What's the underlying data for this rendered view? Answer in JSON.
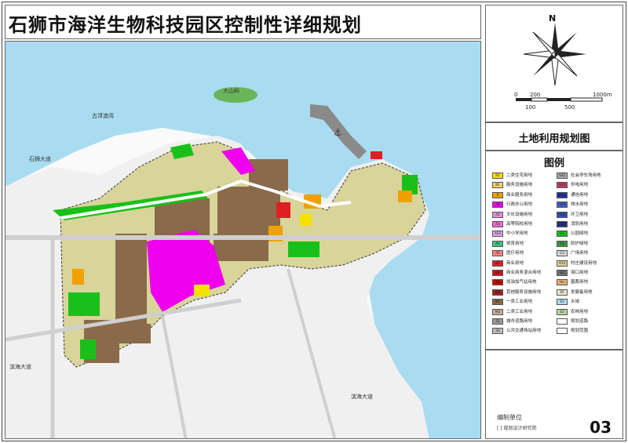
{
  "title": "石狮市海洋生物科技园区控制性详细规划",
  "map_name": "土地利用规划图",
  "legend_title": "图例",
  "compass": {
    "north": "N",
    "icon": "compass-rose-icon"
  },
  "scale": {
    "ticks": [
      "0",
      "200",
      "1000m",
      "100",
      "500"
    ]
  },
  "places": {
    "island": "大山屿",
    "bay": "古浮澳湾",
    "road_left": "石狮大道",
    "road_bottom_left": "滨海大道",
    "road_bottom_right": "滨海大道"
  },
  "legend": [
    {
      "code": "R2",
      "label": "二类住宅用地",
      "color": "#f5e100"
    },
    {
      "code": "B1",
      "label": "服务设施用地",
      "color": "#f3d06a"
    },
    {
      "code": "B",
      "label": "商业服务用地",
      "color": "#f0a000"
    },
    {
      "code": "A1",
      "label": "行政办公用地",
      "color": "#ee00ee"
    },
    {
      "code": "A2",
      "label": "文化设施用地",
      "color": "#e090e0"
    },
    {
      "code": "A3",
      "label": "高等院校用地",
      "color": "#f26ad6"
    },
    {
      "code": "A33",
      "label": "中小学用地",
      "color": "#e6a2e6"
    },
    {
      "code": "A4",
      "label": "体育用地",
      "color": "#43c37e"
    },
    {
      "code": "A5",
      "label": "医疗用地",
      "color": "#ff8080"
    },
    {
      "code": "B1",
      "label": "商业用地",
      "color": "#e02020"
    },
    {
      "code": "B2",
      "label": "商业商务混合用地",
      "color": "#c81818"
    },
    {
      "code": "B4",
      "label": "加油加气站用地",
      "color": "#cc0000"
    },
    {
      "code": "B9",
      "label": "其他服务设施用地",
      "color": "#a02020"
    },
    {
      "code": "M1",
      "label": "一类工业用地",
      "color": "#8a6a4a"
    },
    {
      "code": "M2",
      "label": "二类工业用地",
      "color": "#c7b09a"
    },
    {
      "code": "S1",
      "label": "城市道路用地",
      "color": "#9a9a9a"
    },
    {
      "code": "S3",
      "label": "公共交通场站用地",
      "color": "#bbbbbb"
    },
    {
      "code": "S42",
      "label": "社会停车场用地",
      "color": "#a9a9a9"
    },
    {
      "code": "U11",
      "label": "供电用地",
      "color": "#c04060"
    },
    {
      "code": "U15",
      "label": "通信用地",
      "color": "#2030a0"
    },
    {
      "code": "U21",
      "label": "排水用地",
      "color": "#4060c0"
    },
    {
      "code": "U22",
      "label": "环卫用地",
      "color": "#3050b0"
    },
    {
      "code": "U31",
      "label": "消防用地",
      "color": "#203080"
    },
    {
      "code": "G1",
      "label": "公园绿地",
      "color": "#19c019"
    },
    {
      "code": "G2",
      "label": "防护绿地",
      "color": "#3a9a3a"
    },
    {
      "code": "G3",
      "label": "广场用地",
      "color": "#d9d9d9"
    },
    {
      "code": "H14",
      "label": "村庄建设用地",
      "color": "#e0d49a"
    },
    {
      "code": "H2",
      "label": "港口用地",
      "color": "#707070"
    },
    {
      "code": "Hn",
      "label": "墓葬用地",
      "color": "#e8b070"
    },
    {
      "code": "E9",
      "label": "发展备用地",
      "color": "#e8e8c8"
    },
    {
      "code": "E1",
      "label": "水域",
      "color": "#aaddee"
    },
    {
      "code": "E2",
      "label": "农林用地",
      "color": "#b8d8a0"
    },
    {
      "code": "",
      "label": "规划道路",
      "color": "#ffffff"
    },
    {
      "code": "",
      "label": "规划范围",
      "color": "#ffffff"
    }
  ],
  "stamp": {
    "line1": "编制单位",
    "line2": "[ ] 规划设计研究院",
    "page": "03"
  }
}
